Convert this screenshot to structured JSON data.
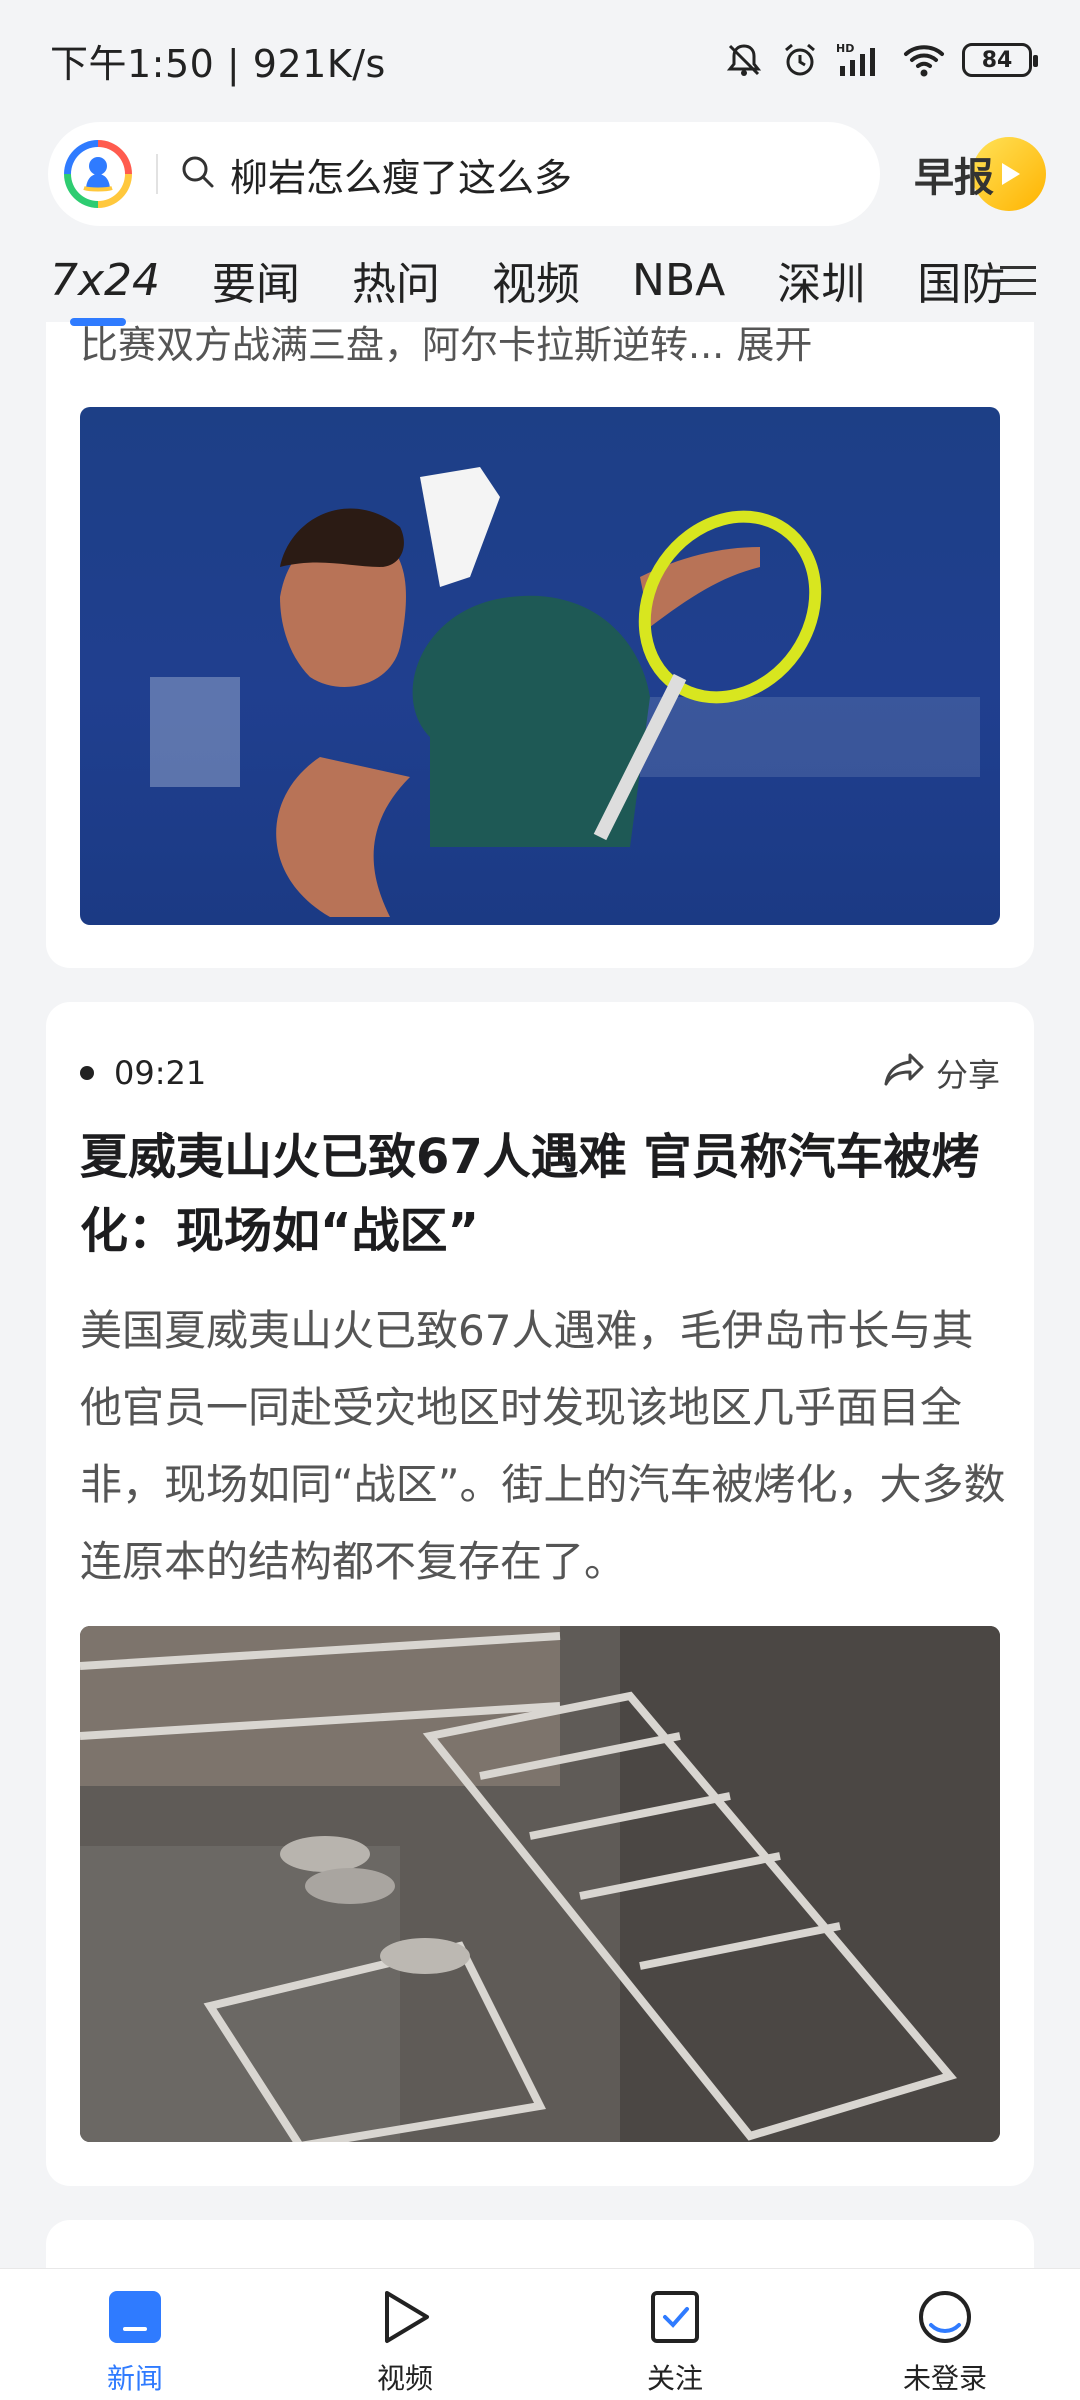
{
  "status": {
    "time_speed": "下午1:50 | 921K/s",
    "battery": "84"
  },
  "search": {
    "query": "柳岩怎么瘦了这么多",
    "morning_label": "早报"
  },
  "tabs": [
    "7x24",
    "要闻",
    "热问",
    "视频",
    "NBA",
    "深圳",
    "国防"
  ],
  "feed": {
    "truncated_text": "比赛双方战满三盘，阿尔卡拉斯逆转... 展开",
    "news": {
      "time": "09:21",
      "share_label": "分享",
      "headline": "夏威夷山火已致67人遇难 官员称汽车被烤化：现场如“战区”",
      "summary": "美国夏威夷山火已致67人遇难，毛伊岛市长与其他官员一同赴受灾地区时发现该地区几乎面目全非，现场如同“战区”。街上的汽车被烤化，大多数连原本的结构都不复存在了。"
    }
  },
  "bottom_nav": [
    {
      "label": "新闻",
      "icon": "news-icon",
      "active": true
    },
    {
      "label": "视频",
      "icon": "video-icon",
      "active": false
    },
    {
      "label": "关注",
      "icon": "follow-icon",
      "active": false
    },
    {
      "label": "未登录",
      "icon": "profile-icon",
      "active": false
    }
  ],
  "colors": {
    "accent": "#2f7bff"
  }
}
